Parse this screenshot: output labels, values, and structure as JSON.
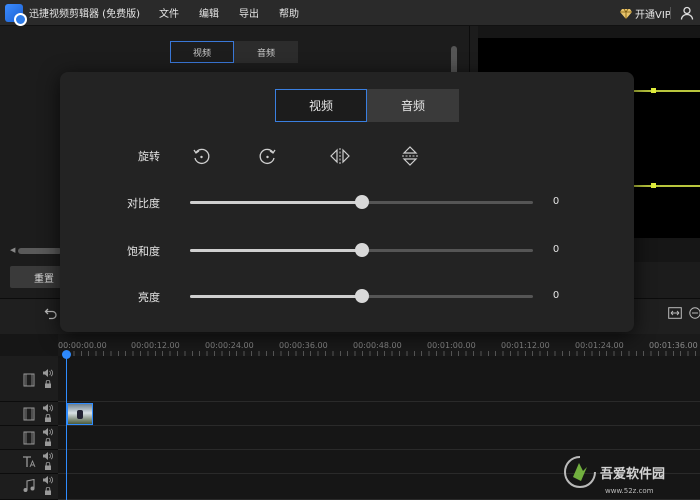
{
  "app": {
    "title": "迅捷视频剪辑器 (免费版)",
    "menu": [
      "文件",
      "编辑",
      "导出",
      "帮助"
    ],
    "vip_label": "开通VIP"
  },
  "background": {
    "tabs": [
      "视频",
      "音频"
    ],
    "active_tab": 0,
    "reset_label": "重置"
  },
  "modal": {
    "tabs": [
      "视频",
      "音频"
    ],
    "active_tab": 0,
    "rotate_label": "旋转",
    "rotate_buttons": [
      "rotate-left-icon",
      "rotate-right-icon",
      "flip-horizontal-icon",
      "flip-vertical-icon"
    ],
    "sliders": [
      {
        "label": "对比度",
        "value": "0",
        "fraction": 0.5
      },
      {
        "label": "饱和度",
        "value": "0",
        "fraction": 0.5
      },
      {
        "label": "亮度",
        "value": "0",
        "fraction": 0.5
      }
    ]
  },
  "timeline": {
    "ticks": [
      "00:00:00.00",
      "00:00:12.00",
      "00:00:24.00",
      "00:00:36.00",
      "00:00:48.00",
      "00:01:00.00",
      "00:01:12.00",
      "00:01:24.00",
      "00:01:36.00"
    ],
    "tracks": [
      "video-track-icon",
      "video-track-icon",
      "video-track-icon",
      "text-track-icon",
      "music-track-icon"
    ]
  },
  "watermark": {
    "text": "吾爱软件园",
    "url": "www.52z.com"
  },
  "colors": {
    "accent": "#3a7fe0",
    "playhead": "#2f8cff",
    "waveform": "#b9c63d"
  }
}
